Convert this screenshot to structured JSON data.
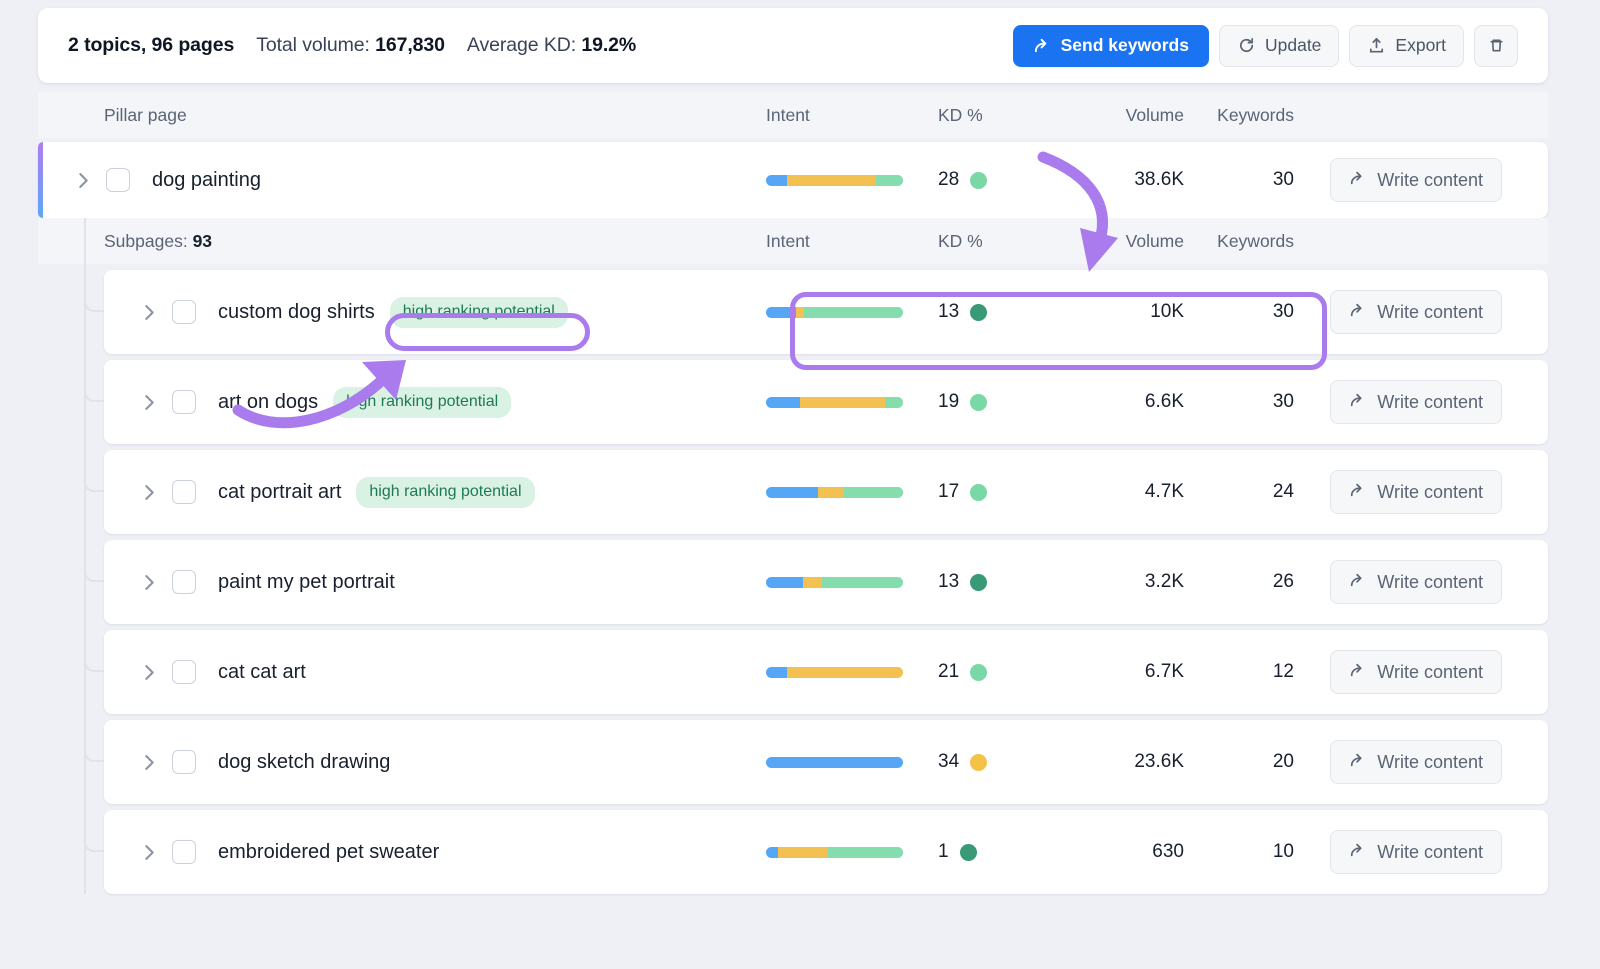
{
  "summary": {
    "topics_pages": "2 topics, 96 pages",
    "total_volume_label": "Total volume:",
    "total_volume_value": "167,830",
    "average_kd_label": "Average KD:",
    "average_kd_value": "19.2%"
  },
  "toolbar": {
    "send_keywords": "Send keywords",
    "update": "Update",
    "export": "Export",
    "delete_icon": "trash-icon"
  },
  "columns": {
    "name": "Pillar page",
    "intent": "Intent",
    "kd": "KD %",
    "volume": "Volume",
    "keywords": "Keywords"
  },
  "pillar": {
    "title": "dog painting",
    "intent": [
      {
        "color": "#55a7f5",
        "pct": 15
      },
      {
        "color": "#f3c152",
        "pct": 65
      },
      {
        "color": "#85dcac",
        "pct": 20
      }
    ],
    "kd": "28",
    "kd_color": "#79d8a5",
    "volume": "38.6K",
    "keywords": "30",
    "action": "Write content"
  },
  "subpages_header": {
    "label": "Subpages:",
    "count": "93"
  },
  "rows": [
    {
      "title": "custom dog shirts",
      "badge": "high ranking potential",
      "intent": [
        {
          "color": "#55a7f5",
          "pct": 22
        },
        {
          "color": "#f3c152",
          "pct": 6
        },
        {
          "color": "#85dcac",
          "pct": 72
        }
      ],
      "kd": "13",
      "kd_color": "#389a77",
      "volume": "10K",
      "keywords": "30",
      "action": "Write content"
    },
    {
      "title": "art on dogs",
      "badge": "high ranking potential",
      "intent": [
        {
          "color": "#55a7f5",
          "pct": 25
        },
        {
          "color": "#f3c152",
          "pct": 62
        },
        {
          "color": "#85dcac",
          "pct": 13
        }
      ],
      "kd": "19",
      "kd_color": "#79d8a5",
      "volume": "6.6K",
      "keywords": "30",
      "action": "Write content"
    },
    {
      "title": "cat portrait art",
      "badge": "high ranking potential",
      "intent": [
        {
          "color": "#55a7f5",
          "pct": 38
        },
        {
          "color": "#f3c152",
          "pct": 19
        },
        {
          "color": "#85dcac",
          "pct": 43
        }
      ],
      "kd": "17",
      "kd_color": "#79d8a5",
      "volume": "4.7K",
      "keywords": "24",
      "action": "Write content"
    },
    {
      "title": "paint my pet portrait",
      "badge": "",
      "intent": [
        {
          "color": "#55a7f5",
          "pct": 27
        },
        {
          "color": "#f3c152",
          "pct": 14
        },
        {
          "color": "#85dcac",
          "pct": 59
        }
      ],
      "kd": "13",
      "kd_color": "#389a77",
      "volume": "3.2K",
      "keywords": "26",
      "action": "Write content"
    },
    {
      "title": "cat cat art",
      "badge": "",
      "intent": [
        {
          "color": "#55a7f5",
          "pct": 15
        },
        {
          "color": "#f3c152",
          "pct": 85
        },
        {
          "color": "#85dcac",
          "pct": 0
        }
      ],
      "kd": "21",
      "kd_color": "#79d8a5",
      "volume": "6.7K",
      "keywords": "12",
      "action": "Write content"
    },
    {
      "title": "dog sketch drawing",
      "badge": "",
      "intent": [
        {
          "color": "#55a7f5",
          "pct": 100
        },
        {
          "color": "#f3c152",
          "pct": 0
        },
        {
          "color": "#85dcac",
          "pct": 0
        }
      ],
      "kd": "34",
      "kd_color": "#f5c councils"
    },
    {
      "title": "embroidered pet sweater",
      "badge": "",
      "intent": [
        {
          "color": "#55a7f5",
          "pct": 9
        },
        {
          "color": "#f3c152",
          "pct": 36
        },
        {
          "color": "#85dcac",
          "pct": 55
        }
      ],
      "kd": "1",
      "kd_color": "#389a77",
      "volume": "630",
      "keywords": "10",
      "action": "Write content"
    }
  ],
  "row_overrides": {
    "dog_sketch": {
      "kd_color": "#f4c247",
      "volume": "23.6K",
      "keywords": "20",
      "action": "Write content"
    }
  },
  "annotations": {
    "highlight_color": "#a97bec",
    "arrow_to_metrics": "curved-arrow-down-icon",
    "arrow_to_badge": "curved-arrow-up-right-icon"
  }
}
